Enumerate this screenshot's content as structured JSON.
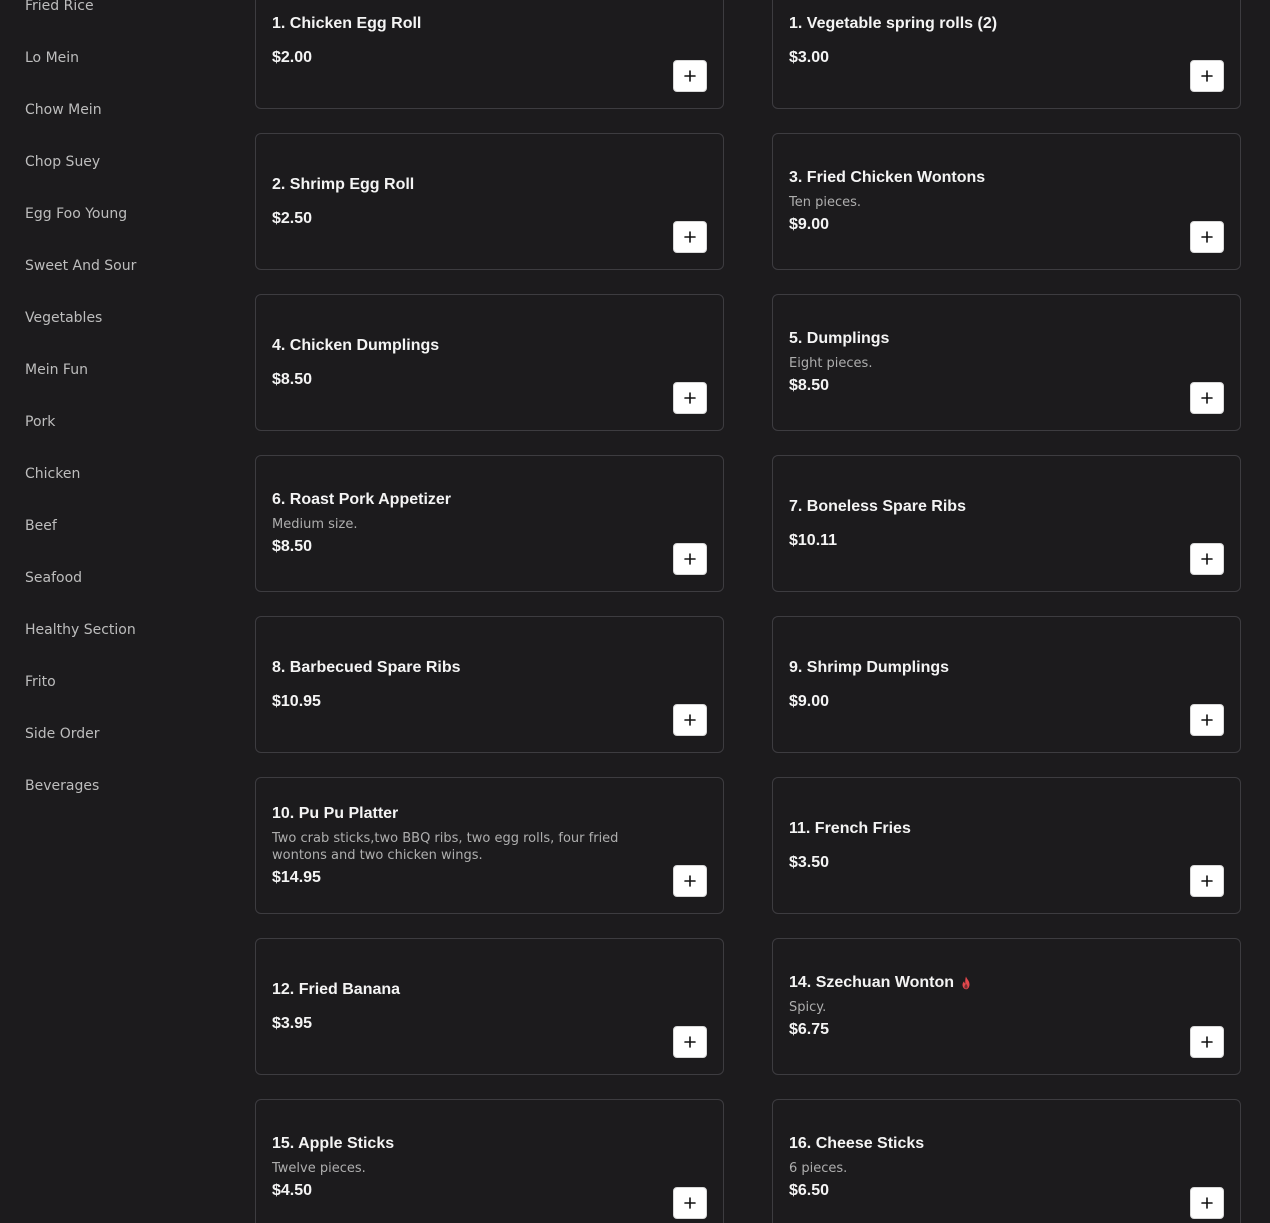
{
  "colors": {
    "background": "#1c1b1d",
    "card_border": "#3d3c40",
    "text_primary": "#f4f4f4",
    "text_secondary": "#aeaeae",
    "sidebar_text": "#bdbdbd",
    "spicy": "#e5484d",
    "button_bg": "#ffffff"
  },
  "sidebar": {
    "items": [
      {
        "label": "Fried Rice"
      },
      {
        "label": "Lo Mein"
      },
      {
        "label": "Chow Mein"
      },
      {
        "label": "Chop Suey"
      },
      {
        "label": "Egg Foo Young"
      },
      {
        "label": "Sweet And Sour"
      },
      {
        "label": "Vegetables"
      },
      {
        "label": "Mein Fun"
      },
      {
        "label": "Pork"
      },
      {
        "label": "Chicken"
      },
      {
        "label": "Beef"
      },
      {
        "label": "Seafood"
      },
      {
        "label": "Healthy Section"
      },
      {
        "label": "Frito"
      },
      {
        "label": "Side Order"
      },
      {
        "label": "Beverages"
      }
    ]
  },
  "menu": {
    "items": [
      {
        "title": "1. Chicken Egg Roll",
        "price": "$2.00",
        "add_icon": "plus-icon"
      },
      {
        "title": "1. Vegetable spring rolls (2)",
        "price": "$3.00",
        "add_icon": "plus-icon"
      },
      {
        "title": "2. Shrimp Egg Roll",
        "price": "$2.50",
        "add_icon": "plus-icon"
      },
      {
        "title": "3. Fried Chicken Wontons",
        "description": "Ten pieces.",
        "price": "$9.00",
        "add_icon": "plus-icon"
      },
      {
        "title": "4. Chicken Dumplings",
        "price": "$8.50",
        "add_icon": "plus-icon"
      },
      {
        "title": "5. Dumplings",
        "description": "Eight pieces.",
        "price": "$8.50",
        "add_icon": "plus-icon"
      },
      {
        "title": "6. Roast Pork Appetizer",
        "description": "Medium size.",
        "price": "$8.50",
        "add_icon": "plus-icon"
      },
      {
        "title": "7. Boneless Spare Ribs",
        "price": "$10.11",
        "add_icon": "plus-icon"
      },
      {
        "title": "8. Barbecued Spare Ribs",
        "price": "$10.95",
        "add_icon": "plus-icon"
      },
      {
        "title": "9. Shrimp Dumplings",
        "price": "$9.00",
        "add_icon": "plus-icon"
      },
      {
        "title": "10. Pu Pu Platter",
        "description": "Two crab sticks,two BBQ ribs, two egg rolls, four fried wontons and two chicken wings.",
        "price": "$14.95",
        "add_icon": "plus-icon"
      },
      {
        "title": "11. French Fries",
        "price": "$3.50",
        "add_icon": "plus-icon"
      },
      {
        "title": "12. Fried Banana",
        "price": "$3.95",
        "add_icon": "plus-icon"
      },
      {
        "title": "14. Szechuan Wonton",
        "spicy": true,
        "spicy_icon": "flame-icon",
        "description": "Spicy.",
        "price": "$6.75",
        "add_icon": "plus-icon"
      },
      {
        "title": "15. Apple Sticks",
        "description": "Twelve pieces.",
        "price": "$4.50",
        "add_icon": "plus-icon"
      },
      {
        "title": "16. Cheese Sticks",
        "description": "6 pieces.",
        "price": "$6.50",
        "add_icon": "plus-icon"
      }
    ]
  }
}
